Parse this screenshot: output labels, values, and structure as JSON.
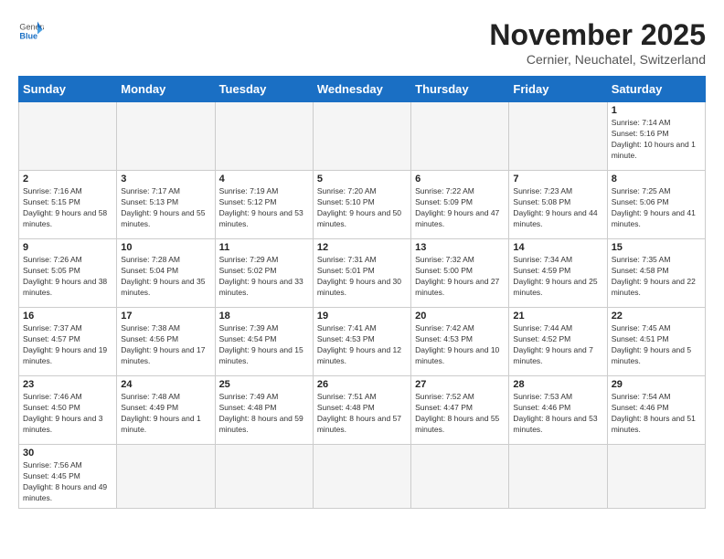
{
  "header": {
    "logo_general": "General",
    "logo_blue": "Blue",
    "month_title": "November 2025",
    "subtitle": "Cernier, Neuchatel, Switzerland"
  },
  "weekdays": [
    "Sunday",
    "Monday",
    "Tuesday",
    "Wednesday",
    "Thursday",
    "Friday",
    "Saturday"
  ],
  "weeks": [
    [
      {
        "day": "",
        "info": ""
      },
      {
        "day": "",
        "info": ""
      },
      {
        "day": "",
        "info": ""
      },
      {
        "day": "",
        "info": ""
      },
      {
        "day": "",
        "info": ""
      },
      {
        "day": "",
        "info": ""
      },
      {
        "day": "1",
        "info": "Sunrise: 7:14 AM\nSunset: 5:16 PM\nDaylight: 10 hours and 1 minute."
      }
    ],
    [
      {
        "day": "2",
        "info": "Sunrise: 7:16 AM\nSunset: 5:15 PM\nDaylight: 9 hours and 58 minutes."
      },
      {
        "day": "3",
        "info": "Sunrise: 7:17 AM\nSunset: 5:13 PM\nDaylight: 9 hours and 55 minutes."
      },
      {
        "day": "4",
        "info": "Sunrise: 7:19 AM\nSunset: 5:12 PM\nDaylight: 9 hours and 53 minutes."
      },
      {
        "day": "5",
        "info": "Sunrise: 7:20 AM\nSunset: 5:10 PM\nDaylight: 9 hours and 50 minutes."
      },
      {
        "day": "6",
        "info": "Sunrise: 7:22 AM\nSunset: 5:09 PM\nDaylight: 9 hours and 47 minutes."
      },
      {
        "day": "7",
        "info": "Sunrise: 7:23 AM\nSunset: 5:08 PM\nDaylight: 9 hours and 44 minutes."
      },
      {
        "day": "8",
        "info": "Sunrise: 7:25 AM\nSunset: 5:06 PM\nDaylight: 9 hours and 41 minutes."
      }
    ],
    [
      {
        "day": "9",
        "info": "Sunrise: 7:26 AM\nSunset: 5:05 PM\nDaylight: 9 hours and 38 minutes."
      },
      {
        "day": "10",
        "info": "Sunrise: 7:28 AM\nSunset: 5:04 PM\nDaylight: 9 hours and 35 minutes."
      },
      {
        "day": "11",
        "info": "Sunrise: 7:29 AM\nSunset: 5:02 PM\nDaylight: 9 hours and 33 minutes."
      },
      {
        "day": "12",
        "info": "Sunrise: 7:31 AM\nSunset: 5:01 PM\nDaylight: 9 hours and 30 minutes."
      },
      {
        "day": "13",
        "info": "Sunrise: 7:32 AM\nSunset: 5:00 PM\nDaylight: 9 hours and 27 minutes."
      },
      {
        "day": "14",
        "info": "Sunrise: 7:34 AM\nSunset: 4:59 PM\nDaylight: 9 hours and 25 minutes."
      },
      {
        "day": "15",
        "info": "Sunrise: 7:35 AM\nSunset: 4:58 PM\nDaylight: 9 hours and 22 minutes."
      }
    ],
    [
      {
        "day": "16",
        "info": "Sunrise: 7:37 AM\nSunset: 4:57 PM\nDaylight: 9 hours and 19 minutes."
      },
      {
        "day": "17",
        "info": "Sunrise: 7:38 AM\nSunset: 4:56 PM\nDaylight: 9 hours and 17 minutes."
      },
      {
        "day": "18",
        "info": "Sunrise: 7:39 AM\nSunset: 4:54 PM\nDaylight: 9 hours and 15 minutes."
      },
      {
        "day": "19",
        "info": "Sunrise: 7:41 AM\nSunset: 4:53 PM\nDaylight: 9 hours and 12 minutes."
      },
      {
        "day": "20",
        "info": "Sunrise: 7:42 AM\nSunset: 4:53 PM\nDaylight: 9 hours and 10 minutes."
      },
      {
        "day": "21",
        "info": "Sunrise: 7:44 AM\nSunset: 4:52 PM\nDaylight: 9 hours and 7 minutes."
      },
      {
        "day": "22",
        "info": "Sunrise: 7:45 AM\nSunset: 4:51 PM\nDaylight: 9 hours and 5 minutes."
      }
    ],
    [
      {
        "day": "23",
        "info": "Sunrise: 7:46 AM\nSunset: 4:50 PM\nDaylight: 9 hours and 3 minutes."
      },
      {
        "day": "24",
        "info": "Sunrise: 7:48 AM\nSunset: 4:49 PM\nDaylight: 9 hours and 1 minute."
      },
      {
        "day": "25",
        "info": "Sunrise: 7:49 AM\nSunset: 4:48 PM\nDaylight: 8 hours and 59 minutes."
      },
      {
        "day": "26",
        "info": "Sunrise: 7:51 AM\nSunset: 4:48 PM\nDaylight: 8 hours and 57 minutes."
      },
      {
        "day": "27",
        "info": "Sunrise: 7:52 AM\nSunset: 4:47 PM\nDaylight: 8 hours and 55 minutes."
      },
      {
        "day": "28",
        "info": "Sunrise: 7:53 AM\nSunset: 4:46 PM\nDaylight: 8 hours and 53 minutes."
      },
      {
        "day": "29",
        "info": "Sunrise: 7:54 AM\nSunset: 4:46 PM\nDaylight: 8 hours and 51 minutes."
      }
    ],
    [
      {
        "day": "30",
        "info": "Sunrise: 7:56 AM\nSunset: 4:45 PM\nDaylight: 8 hours and 49 minutes."
      },
      {
        "day": "",
        "info": ""
      },
      {
        "day": "",
        "info": ""
      },
      {
        "day": "",
        "info": ""
      },
      {
        "day": "",
        "info": ""
      },
      {
        "day": "",
        "info": ""
      },
      {
        "day": "",
        "info": ""
      }
    ]
  ]
}
